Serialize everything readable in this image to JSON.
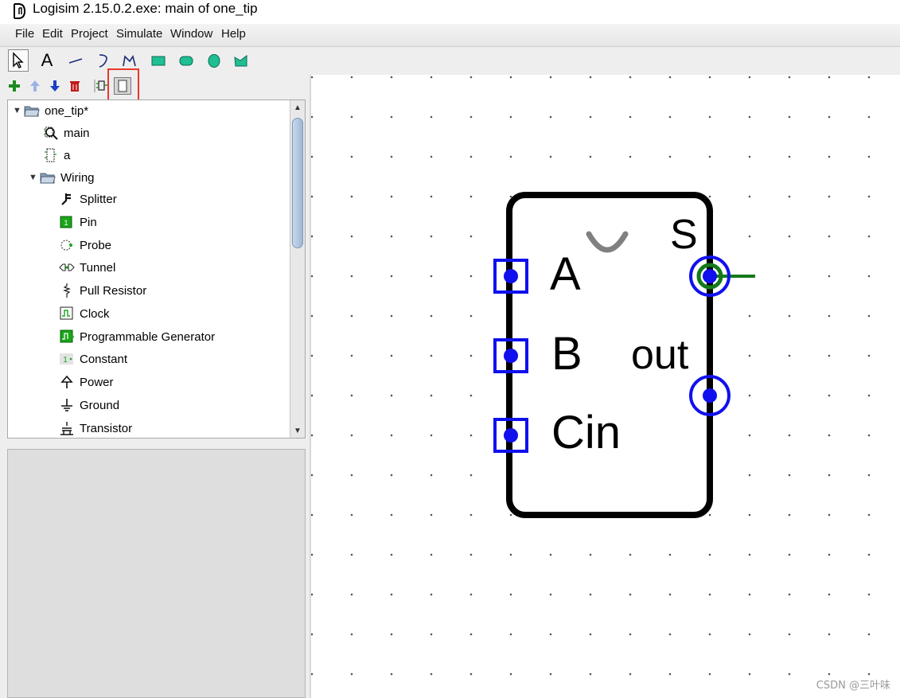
{
  "window": {
    "title": "Logisim 2.15.0.2.exe: main of one_tip"
  },
  "menu": [
    "File",
    "Edit",
    "Project",
    "Simulate",
    "Window",
    "Help"
  ],
  "tools": [
    {
      "name": "poke-tool-icon"
    },
    {
      "name": "text-tool-icon",
      "glyph": "A"
    },
    {
      "name": "line-tool-icon"
    },
    {
      "name": "curve-tool-icon"
    },
    {
      "name": "polyline-tool-icon"
    },
    {
      "name": "rectangle-tool-icon"
    },
    {
      "name": "rounded-rectangle-tool-icon"
    },
    {
      "name": "oval-tool-icon"
    },
    {
      "name": "polygon-tool-icon"
    }
  ],
  "explorer_toolbar": [
    "add-circuit-icon",
    "move-up-icon",
    "move-down-icon",
    "delete-icon",
    "edit-layout-icon",
    "edit-appearance-icon"
  ],
  "tree": {
    "project": "one_tip*",
    "circuits": [
      "main",
      "a"
    ],
    "library": "Wiring",
    "wiring_items": [
      "Splitter",
      "Pin",
      "Probe",
      "Tunnel",
      "Pull Resistor",
      "Clock",
      "Programmable Generator",
      "Constant",
      "Power",
      "Ground",
      "Transistor"
    ]
  },
  "canvas": {
    "ports": [
      "A",
      "B",
      "Cin"
    ],
    "outputs": [
      "S",
      "out"
    ]
  },
  "watermark": "CSDN @三叶味",
  "colors": {
    "port": "#1010ee",
    "wire": "#137a1b",
    "highlight": "#e8392b"
  }
}
